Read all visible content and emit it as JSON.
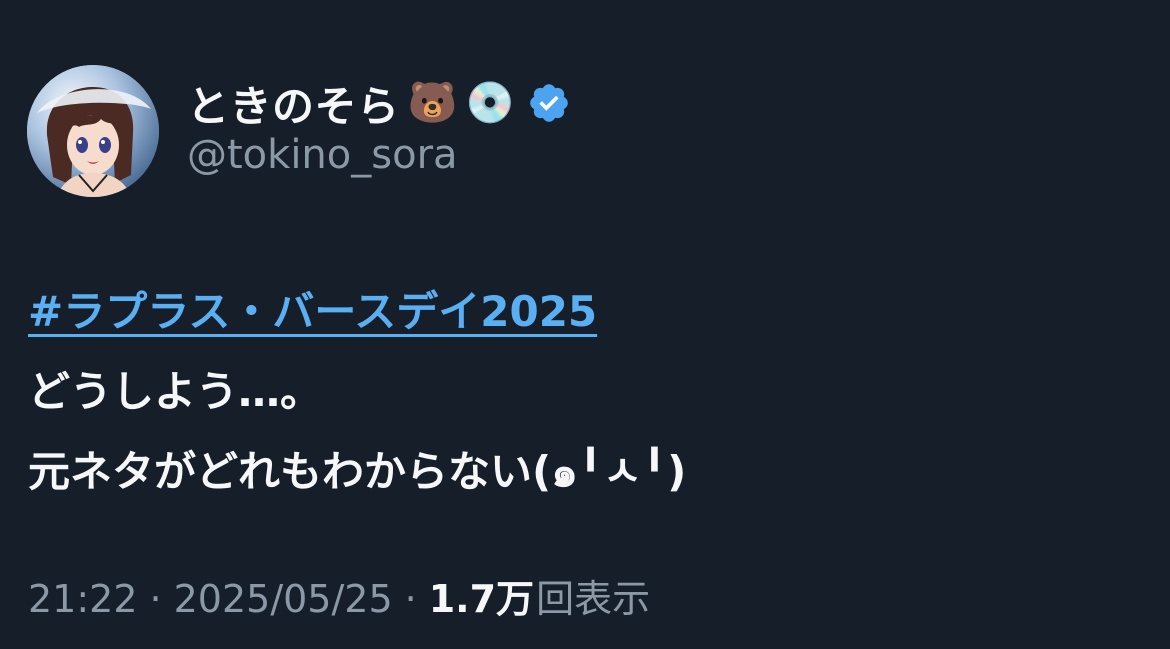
{
  "tweet": {
    "author": {
      "display_name": "ときのそら",
      "emoji_1": "🐻",
      "emoji_2": "💿",
      "handle": "@tokino_sora",
      "verified": true
    },
    "body": {
      "hashtag": "#ラプラス・バースデイ2025",
      "line_2": "どうしよう…。",
      "line_3": "元ネタがどれもわからない(๑╹ㅅ╹)"
    },
    "meta": {
      "time": "21:22",
      "separator": "·",
      "date": "2025/05/25",
      "views_count": "1.7万",
      "views_label": "回表示"
    }
  },
  "colors": {
    "background": "#161f29",
    "link": "#5aaef2",
    "verified": "#4ca3f0",
    "muted": "#8b98a5",
    "text": "#f5f7f8"
  },
  "icons": {
    "verified": "verified-badge-icon"
  }
}
